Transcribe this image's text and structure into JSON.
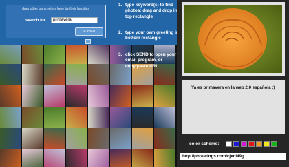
{
  "search": {
    "drag_hint": "drag other parameters here by their handles",
    "label": "search for",
    "value": "primavera",
    "submit_label": "SUBMIT"
  },
  "instructions": [
    {
      "number": "1.",
      "text": "type keyword(s) to find photos; drag and drop into top rectangle"
    },
    {
      "number": "2.",
      "text": "type your own greeting in bottom rectangle"
    },
    {
      "number": "3.",
      "text": "click SEND to open your email program, or copy/paste URL"
    }
  ],
  "greeting": {
    "text": "Ya es primavera en la web 2.0 española :)"
  },
  "color_scheme": {
    "label": "color scheme:",
    "colors": [
      "#ffffff",
      "#1c1cd6",
      "#d41ad4",
      "#e01818",
      "#f29a1c",
      "#f2e41c",
      "#16b41c"
    ]
  },
  "share": {
    "url": "http://phreetings.com/cjxqi49g"
  },
  "theme": {
    "panel_blue": "#2366a8",
    "background": "#262626"
  }
}
